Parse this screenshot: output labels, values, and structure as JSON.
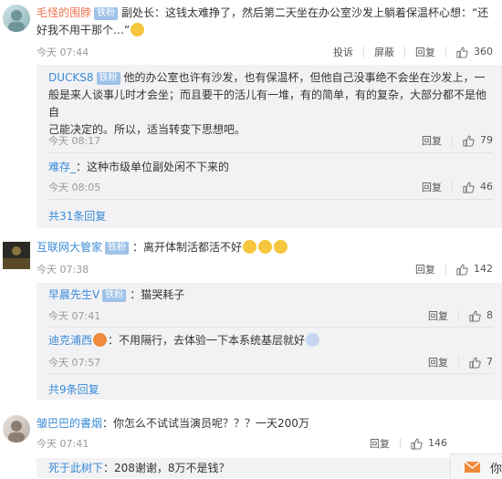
{
  "comment1": {
    "username": "毛怪的围脖",
    "badge": "铁粉",
    "text": "副处长：这钱太难挣了，然后第二天坐在办公室沙发上躺着保温杯心想：“还好我不用干那个…”",
    "time": "今天 07:44",
    "actions": {
      "report": "投诉",
      "block": "屏蔽",
      "reply": "回复",
      "likes": "360"
    },
    "replies": [
      {
        "username": "DUCKS8",
        "badge": "铁粉",
        "line1": "他的办公室也许有沙发，也有保温杯，但他自己没事绝不会坐在沙发上，一",
        "line2": "般是来人谈事儿时才会坐；而且要干的活儿有一堆，有的简单，有的复杂，大部分都不是他自",
        "line3": "己能决定的。所以，适当转变下思想吧。",
        "time": "今天 08:17",
        "reply": "回复",
        "likes": "79"
      },
      {
        "username": "难存_",
        "text": "：这种市级单位副处闲不下来的",
        "time": "今天 08:05",
        "reply": "回复",
        "likes": "46"
      }
    ],
    "more": "共31条回复"
  },
  "comment2": {
    "username": "互联网大管家",
    "badge": "铁粉",
    "text": "：离开体制活都活不好",
    "time": "今天 07:38",
    "reply": "回复",
    "likes": "142",
    "replies": [
      {
        "username": "早晨先生V",
        "badge": "铁粉",
        "text": "：猫哭耗子",
        "time": "今天 07:41",
        "reply": "回复",
        "likes": "8"
      },
      {
        "username": "迪克浦西",
        "text": "：不用隔行，去体验一下本系统基层就好",
        "time": "今天 07:57",
        "reply": "回复",
        "likes": "7"
      }
    ],
    "more": "共9条回复"
  },
  "comment3": {
    "username": "皱巴巴的書烟",
    "text": "：你怎么不试试当演员呢？？？一天200万",
    "time": "今天 07:41",
    "reply": "回复",
    "likes": "146",
    "replies": [
      {
        "username": "死于此树下",
        "text": "：208谢谢，8万不是钱？"
      }
    ]
  },
  "floating": {
    "label": "你"
  },
  "colors": {
    "username": "#eb7350",
    "link": "#3a8bd6",
    "badge": "#9ec2e8",
    "reply_bg": "#f2f2f5"
  }
}
